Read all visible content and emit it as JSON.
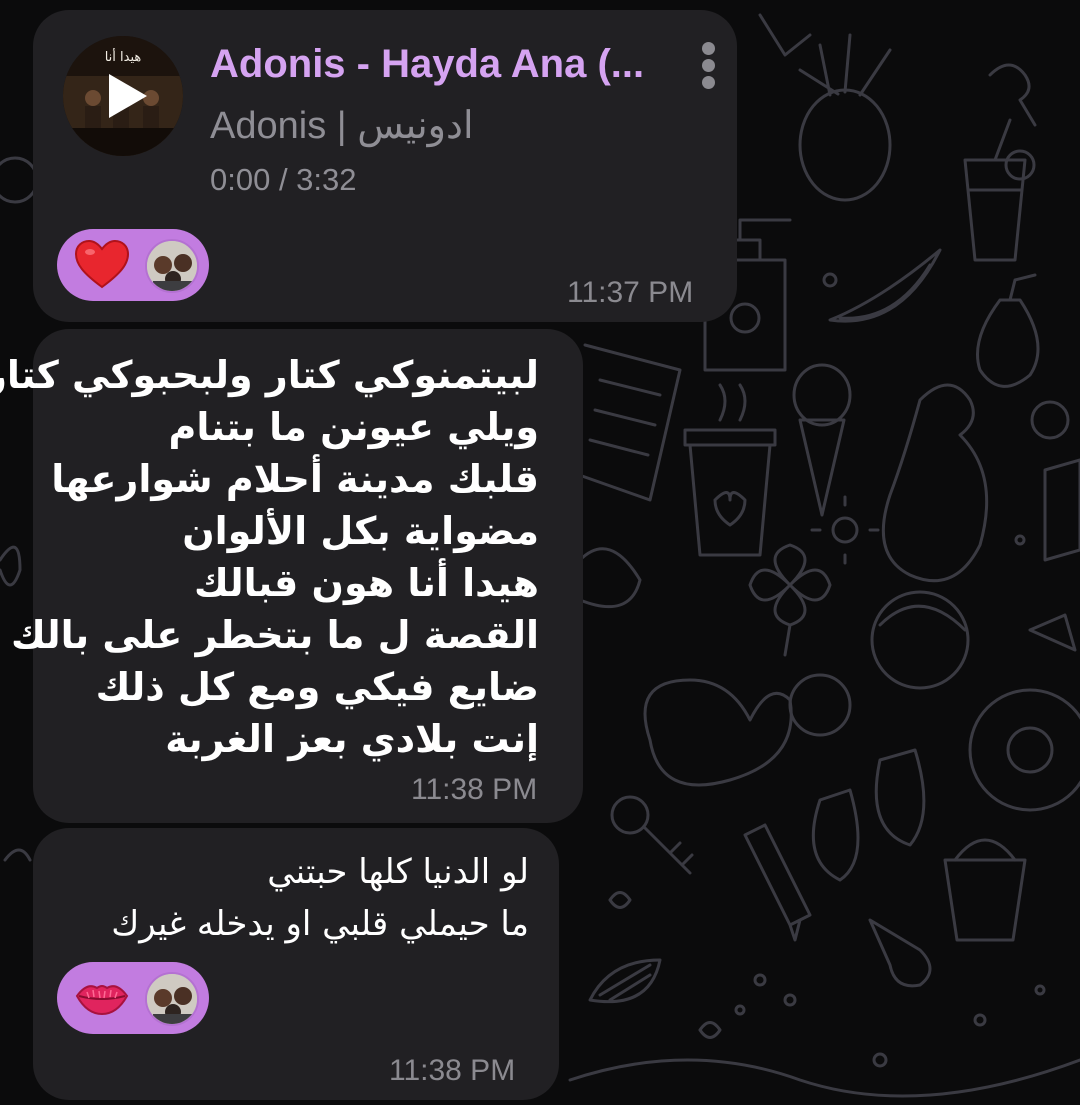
{
  "audio_message": {
    "cover_caption": "هيدا أنا",
    "title": "Adonis - Hayda Ana (...",
    "artist": "Adonis | ادونيس",
    "time": "0:00 / 3:32",
    "reaction_icon": "red-heart-emoji",
    "timestamp": "11:37 PM"
  },
  "lyrics_message": {
    "lines": [
      "لبيتمنوكي كتار ولبحبوكي كتار",
      "ويلي عيونن ما بتنام",
      "قلبك مدينة أحلام شوارعها",
      "مضواية بكل الألوان",
      "هيدا أنا هون قبالك",
      "القصة ل ما بتخطر على بالك",
      "ضايع فيكي ومع كل ذلك",
      "إنت بلادي بعز الغربة"
    ],
    "timestamp": "11:38 PM"
  },
  "reply_message": {
    "lines": [
      "لو الدنيا كلها حبتني",
      "ما حيملي قلبي او يدخله غيرك"
    ],
    "reaction_icon": "lips-kiss-emoji",
    "timestamp": "11:38 PM"
  },
  "colors": {
    "bubble": "#212023",
    "accent": "#d5a3f1",
    "reaction_pill": "#c27ce0",
    "secondary_text": "#8f8e95",
    "background": "#0b0b0c"
  }
}
